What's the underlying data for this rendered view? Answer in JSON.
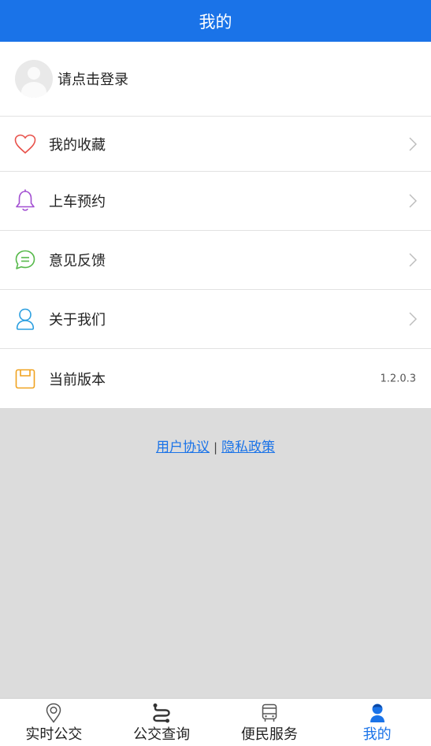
{
  "header": {
    "title": "我的"
  },
  "profile": {
    "login_prompt": "请点击登录"
  },
  "menu": {
    "items": [
      {
        "label": "我的收藏",
        "icon": "heart-icon",
        "color": "#e8514a"
      },
      {
        "label": "上车预约",
        "icon": "bell-icon",
        "color": "#a24fd1"
      },
      {
        "label": "意见反馈",
        "icon": "chat-bubble-icon",
        "color": "#56b94a"
      },
      {
        "label": "关于我们",
        "icon": "user-outline-icon",
        "color": "#2b9fe0"
      },
      {
        "label": "当前版本",
        "icon": "floppy-disk-icon",
        "color": "#f0a21f",
        "value": "1.2.0.3"
      }
    ]
  },
  "footer_links": {
    "user_agreement": "用户协议",
    "separator": "|",
    "privacy_policy": "隐私政策",
    "link_color": "#1a73e8"
  },
  "tabbar": {
    "tabs": [
      {
        "label": "实时公交",
        "icon": "location-pin-icon"
      },
      {
        "label": "公交查询",
        "icon": "route-icon"
      },
      {
        "label": "便民服务",
        "icon": "bus-icon"
      },
      {
        "label": "我的",
        "icon": "user-icon",
        "active": true
      }
    ],
    "active_color": "#1a73e8"
  },
  "colors": {
    "header_bg": "#1a73e8",
    "page_bg": "#dcdcdc"
  }
}
